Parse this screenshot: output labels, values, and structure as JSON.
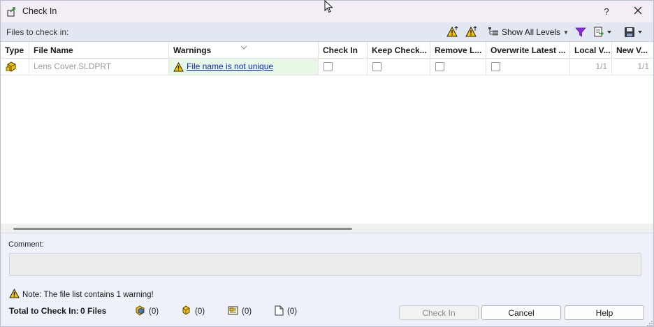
{
  "window": {
    "title": "Check In",
    "help_label": "?",
    "icons": {
      "app": "check-in-app-icon",
      "close": "close-icon"
    }
  },
  "toolbar": {
    "files_label": "Files to check in:",
    "levels_label": "Show All Levels",
    "icons": [
      "warning-up-icon",
      "warning-arrow-icon",
      "levels-tree-icon",
      "filter-icon",
      "export-icon",
      "save-icon"
    ]
  },
  "grid": {
    "columns": [
      "Type",
      "File Name",
      "Warnings",
      "Check In",
      "Keep Check...",
      "Remove L...",
      "Overwrite Latest ...",
      "Local V...",
      "New V..."
    ],
    "rows": [
      {
        "type_icon": "part-file-icon",
        "file_name": "Lens Cover.SLDPRT",
        "warning": "File name is not unique",
        "check_in": false,
        "keep_checked_out": false,
        "remove_local": false,
        "overwrite_latest": false,
        "local_version": "1/1",
        "new_version": "1/1"
      }
    ]
  },
  "footer": {
    "comment_label": "Comment:",
    "comment_value": "",
    "note": "Note: The file list contains 1 warning!",
    "total_label": "Total to Check In:",
    "total_value": "0 Files",
    "counts": [
      {
        "icon": "assembly-icon",
        "value": "(0)"
      },
      {
        "icon": "part-icon",
        "value": "(0)"
      },
      {
        "icon": "drawing-icon",
        "value": "(0)"
      },
      {
        "icon": "document-icon",
        "value": "(0)"
      }
    ],
    "buttons": {
      "check_in": "Check In",
      "cancel": "Cancel",
      "help": "Help"
    }
  },
  "colors": {
    "warning_bg": "#e8f8e6",
    "link": "#0a24c8",
    "toolbar_bg": "#e3e7f2",
    "panel_bg": "#eef1f9"
  }
}
